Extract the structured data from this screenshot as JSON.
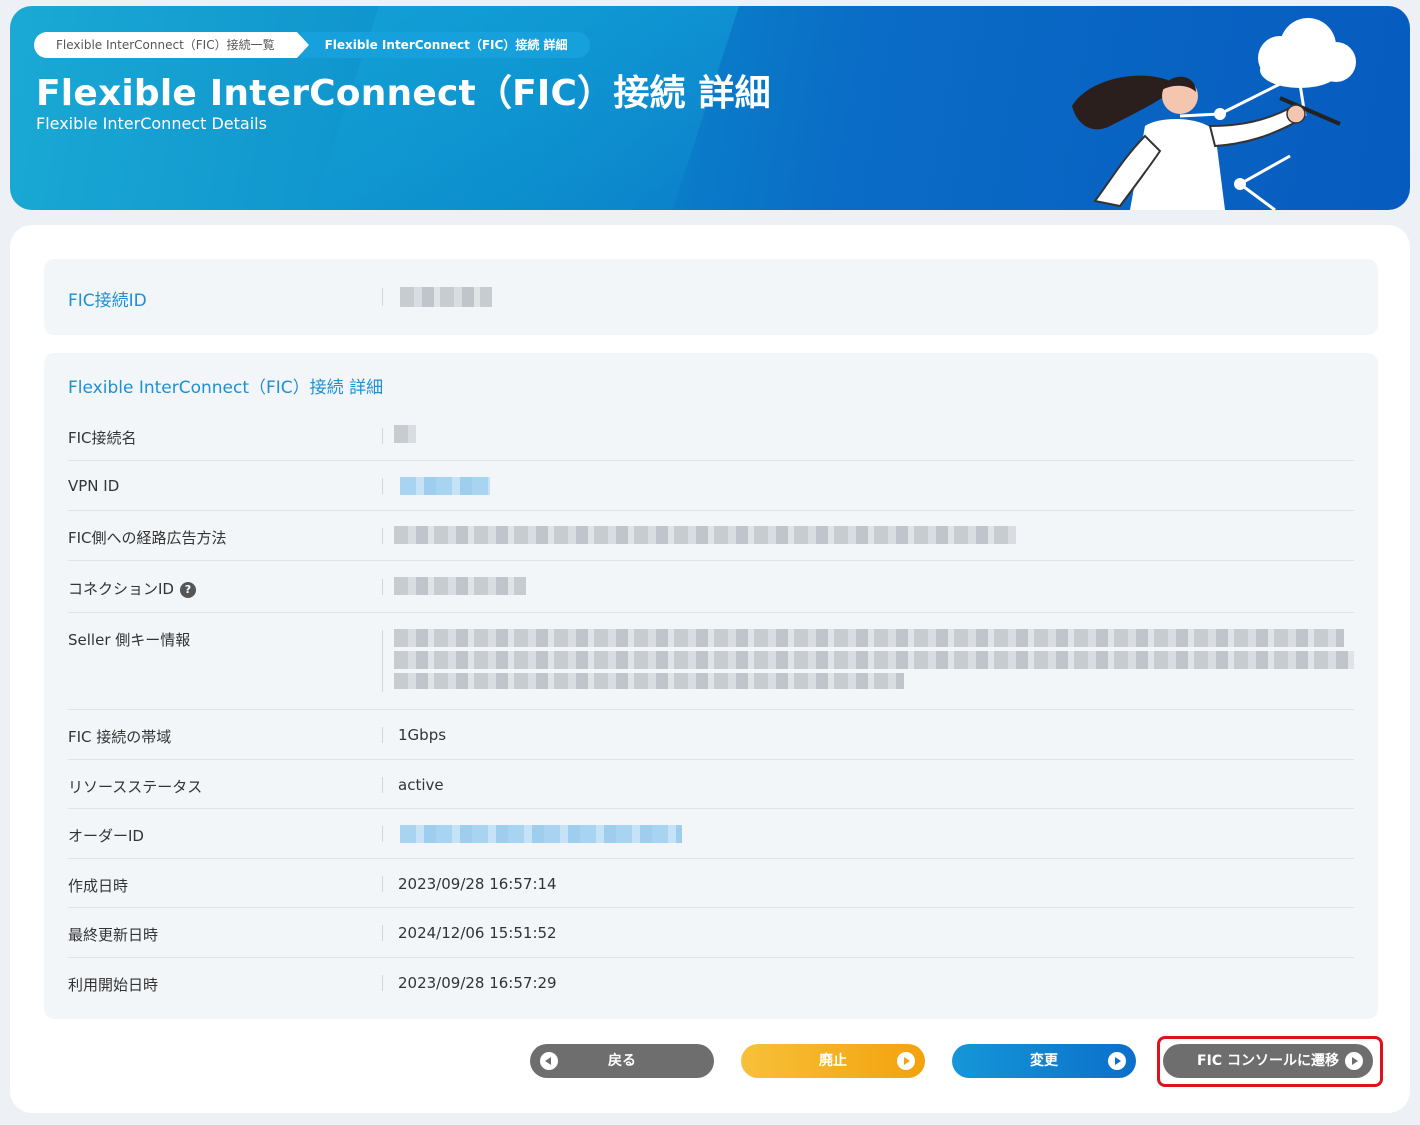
{
  "header": {
    "breadcrumbs": [
      "Flexible InterConnect（FIC）接続一覧",
      "Flexible InterConnect（FIC）接続 詳細"
    ],
    "title": "Flexible InterConnect（FIC）接続 詳細",
    "subtitle": "Flexible InterConnect Details"
  },
  "id_panel": {
    "label": "FIC接続ID"
  },
  "detail": {
    "section_title": "Flexible InterConnect（FIC）接続 詳細",
    "rows": [
      {
        "label": "FIC接続名",
        "value": ""
      },
      {
        "label": "VPN ID",
        "value": ""
      },
      {
        "label": "FIC側への経路広告方法",
        "value": ""
      },
      {
        "label": "コネクションID",
        "value": ""
      },
      {
        "label": "Seller 側キー情報",
        "value": ""
      },
      {
        "label": "FIC 接続の帯域",
        "value": "1Gbps"
      },
      {
        "label": "リソースステータス",
        "value": "active"
      },
      {
        "label": "オーダーID",
        "value": ""
      },
      {
        "label": "作成日時",
        "value": "2023/09/28 16:57:14"
      },
      {
        "label": "最終更新日時",
        "value": "2024/12/06 15:51:52"
      },
      {
        "label": "利用開始日時",
        "value": "2023/09/28 16:57:29"
      }
    ],
    "help_icon": "?"
  },
  "buttons": {
    "back": "戻る",
    "abolish": "廃止",
    "change": "変更",
    "console": "FIC コンソールに遷移"
  },
  "colors": {
    "accent": "#1d8fd3",
    "highlight": "#e0111b"
  }
}
